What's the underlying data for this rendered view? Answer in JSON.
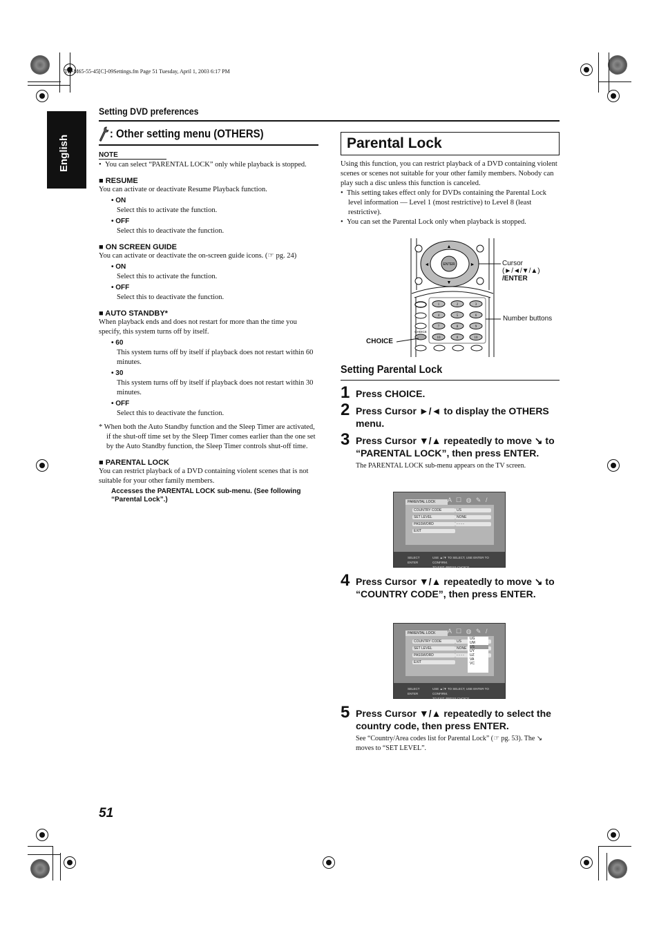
{
  "file_info": "TH-M65-55-45[C]-09Settings.fm  Page 51  Tuesday, April 1, 2003  6:17 PM",
  "language_tab": "English",
  "section_title": "Setting DVD preferences",
  "left": {
    "others_icon": "wrench-icon",
    "others_title": ": Other setting menu (OTHERS)",
    "note_label": "NOTE",
    "note_text": "You can select “PARENTAL LOCK” only while playback is stopped.",
    "items": [
      {
        "heading": "■ RESUME",
        "desc": "You can activate or deactivate Resume Playback function.",
        "options": [
          {
            "label": "• ON",
            "desc": "Select this to activate the function."
          },
          {
            "label": "• OFF",
            "desc": "Select this to deactivate the function."
          }
        ]
      },
      {
        "heading": "■ ON SCREEN GUIDE",
        "desc": "You can activate or deactivate the on-screen guide icons. (☞ pg. 24)",
        "options": [
          {
            "label": "• ON",
            "desc": "Select this to activate the function."
          },
          {
            "label": "• OFF",
            "desc": "Select this to deactivate the function."
          }
        ]
      },
      {
        "heading": "■ AUTO STANDBY*",
        "desc": "When playback ends and does not restart for more than the time you specify, this system turns off by itself.",
        "options": [
          {
            "label": "• 60",
            "desc": "This system turns off by itself if playback does not restart within 60 minutes."
          },
          {
            "label": "• 30",
            "desc": "This system turns off by itself if playback does not restart within 30 minutes."
          },
          {
            "label": "• OFF",
            "desc": "Select this to deactivate the function."
          }
        ]
      }
    ],
    "footnote": "* When both the Auto Standby function and the Sleep Timer are activated, if the shut-off time set by the Sleep Timer comes earlier than the one set by the Auto Standby function, the Sleep Timer controls shut-off time.",
    "parental": {
      "heading": "■ PARENTAL LOCK",
      "desc": "You can restrict playback of a DVD containing violent scenes that is not suitable for your other family members.",
      "access": "Accesses the PARENTAL LOCK sub-menu. (See following “Parental Lock”.)"
    }
  },
  "right": {
    "title": "Parental Lock",
    "intro": "Using this function, you can restrict playback of a DVD containing violent scenes or scenes not suitable for your other family members. Nobody can play such a disc unless this function is canceled.",
    "bullets": [
      "This setting takes effect only for DVDs containing the Parental Lock level information — Level 1 (most restrictive) to Level 8 (least restrictive).",
      "You can set the Parental Lock only when playback is stopped."
    ],
    "remote": {
      "enter_label": "ENTER",
      "choice_small": "CHOICE",
      "number_keys": [
        "1",
        "2",
        "3",
        "4",
        "5",
        "6",
        "7",
        "8",
        "9",
        "10",
        "0",
        "10"
      ],
      "callout_cursor": [
        "Cursor",
        "(►/◄/▼/▲)",
        "/ENTER"
      ],
      "callout_numbers": "Number buttons",
      "callout_choice": "CHOICE"
    },
    "setting_heading": "Setting Parental Lock",
    "steps": [
      {
        "num": "1",
        "text": "Press CHOICE."
      },
      {
        "num": "2",
        "text": "Press Cursor ►/◄ to display the OTHERS menu."
      },
      {
        "num": "3",
        "text": "Press Cursor ▼/▲ repeatedly to move ↘ to “PARENTAL LOCK”, then press ENTER.",
        "sub": "The PARENTAL LOCK sub-menu appears on the TV screen."
      },
      {
        "num": "4",
        "text": "Press Cursor ▼/▲ repeatedly to move ↘ to “COUNTRY CODE”, then press ENTER."
      },
      {
        "num": "5",
        "text": "Press Cursor ▼/▲ repeatedly to select the country code, then press ENTER.",
        "sub": "See “Country/Area codes list for Parental Lock” (☞ pg. 53). The ↘ moves to “SET LEVEL”."
      }
    ],
    "screens": [
      {
        "tab": "PARENTAL LOCK",
        "rows": [
          {
            "label": "COUNTRY CODE",
            "value": "US"
          },
          {
            "label": "SET LEVEL",
            "value": "NONE"
          },
          {
            "label": "PASSWORD",
            "value": "- - - -"
          },
          {
            "label": "EXIT",
            "value": ""
          }
        ],
        "footer_left": [
          "SELECT",
          "ENTER"
        ],
        "footer_text": [
          "USE ▲/▼ TO SELECT, USE ENTER TO CONFIRM.",
          "TO EXIT, PRESS CHOICE."
        ]
      },
      {
        "tab": "PARENTAL LOCK",
        "rows": [
          {
            "label": "COUNTRY CODE",
            "value": "US"
          },
          {
            "label": "SET LEVEL",
            "value": "NONE"
          },
          {
            "label": "PASSWORD",
            "value": "- - - -"
          },
          {
            "label": "EXIT",
            "value": ""
          }
        ],
        "list": [
          "UG",
          "UM",
          "US",
          "UY",
          "UZ",
          "VA",
          "VC"
        ],
        "list_selected": "US",
        "footer_left": [
          "SELECT",
          "ENTER"
        ],
        "footer_text": [
          "USE ▲/▼ TO SELECT, USE ENTER TO CONFIRM.",
          "TO EXIT, PRESS CHOICE."
        ]
      }
    ]
  },
  "page_number": "51"
}
